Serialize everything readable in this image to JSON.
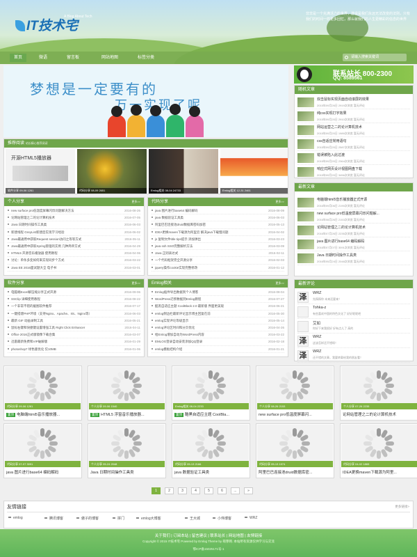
{
  "header": {
    "logo_text": "IT技术宅",
    "tagline": "A Blog About Tech",
    "intro": "非非是一个充满活力的世界，游说是我们永远无法改变的法则，只有我们的时间一样更多回忆，那么就我们的人生更精彩的信念的世界"
  },
  "nav": {
    "items": [
      {
        "label": "首页",
        "active": true
      },
      {
        "label": "微语",
        "active": false
      },
      {
        "label": "留言板",
        "active": false
      },
      {
        "label": "网站地图",
        "active": false
      },
      {
        "label": "标签分类",
        "active": false
      }
    ],
    "search_placeholder": "请输入搜索关键词"
  },
  "banner": {
    "line1": "梦想是一定要有的",
    "line2": "万一实现了呢"
  },
  "contact": {
    "title": "联系站长 800-2300",
    "qq": "QQ: 8589561"
  },
  "recommend": {
    "title": "推荐阅读",
    "subtitle": "站长精心推荐阅读",
    "items": [
      {
        "caption": "开源HTML5播放器",
        "meta": "软件分享  09-06  1261"
      },
      {
        "caption": "",
        "meta": "代码分享  08-09  2651"
      },
      {
        "caption": "",
        "meta": "Emlog相关  08-04  24733"
      },
      {
        "caption": "",
        "meta": "Emlog相关  12-31  2461"
      }
    ]
  },
  "personal": {
    "title": "个人分享",
    "more": "更多>>",
    "rows": [
      {
        "text": "new surface pro低温度屏幕闪烁问题解决方法",
        "date": "2016-08-26"
      },
      {
        "text": "论网站管理之二的论计算机技术",
        "date": "2016-07-05"
      },
      {
        "text": "Java 日期时间操作工具类",
        "date": "2016-06-03"
      },
      {
        "text": "新建线程 GreyList新建后实现学习经验",
        "date": "2016-06-02"
      },
      {
        "text": "Java最通用中获取Request session访问之等等方式",
        "date": "2016-05-11"
      },
      {
        "text": "Java最通用中获取Spring管理的实例 几种简单方式",
        "date": "2016-04-29"
      },
      {
        "text": "HTML5 开源音乐播放器 使用教程",
        "date": "2016-04-06"
      },
      {
        "text": "讨论：单条多变如何来实现同步个方式",
        "date": "2016-03-22"
      },
      {
        "text": "Java EE 2016面试题大全 电子书",
        "date": "2016-03-01"
      }
    ]
  },
  "code": {
    "title": "代码分享",
    "more": "更多>>",
    "rows": [
      {
        "text": "java 图片进行base64 编码解码",
        "date": "2016-08-09"
      },
      {
        "text": "java 数据验证工具类",
        "date": "2016-06-03"
      },
      {
        "text": "阿里巴巴连接池druid数据库密码加密",
        "date": "2016-05-13"
      },
      {
        "text": "IDEA更换maven下载源为阿里云 解决java下载慢问题",
        "date": "2016-04-02"
      },
      {
        "text": "js 复制文件title tips提示 添加弹出",
        "date": "2016-03-23"
      },
      {
        "text": "java ssh SSO完整解析方法",
        "date": "2016-03-09"
      },
      {
        "text": "Java 正则表达式",
        "date": "2016-02-11"
      },
      {
        "text": "一个代码框架完全开源分享",
        "date": "2016-02-03"
      },
      {
        "text": "jquery操作cookie实现完整修改",
        "date": "2016-01-12"
      }
    ]
  },
  "software": {
    "title": "软件分享",
    "more": "更多>>",
    "rows": [
      {
        "text": "电脑端Excel解压缩分享正式开源",
        "date": "2016-09-06"
      },
      {
        "text": "SSClip 详细使用教程",
        "date": "2016-08-22"
      },
      {
        "text": "一个非常不错的截图软件推荐",
        "date": "2016-07-17"
      },
      {
        "text": "一键搭建PHP环境（支持Nginx、Apache、IIS、Nginx等）",
        "date": "2016-06-03"
      },
      {
        "text": "最新 GIF 动画录制工具",
        "date": "2016-05-21"
      },
      {
        "text": "鼠标右键和快捷键设置增强工具 Right Click Enhancer",
        "date": "2016-04-11"
      },
      {
        "text": "Office 2016正式版镜像下载合集",
        "date": "2016-03-07"
      },
      {
        "text": "迅雷最新免费和VIP破解版",
        "date": "2016-01-29"
      },
      {
        "text": "photoshop7 绿色版优化 仅10MB",
        "date": "2016-01-06"
      }
    ]
  },
  "emlog": {
    "title": "Emlog相关",
    "more": "更多>>",
    "rows": [
      {
        "text": "Emlog插件导出数据到个人博客",
        "date": "2016-08-04"
      },
      {
        "text": "WordPress迁移数据到Emlog教程",
        "date": "2016-07-27"
      },
      {
        "text": "酷黑自适应主题 CoolBlack 2.0 最新版 界面更美观",
        "date": "2016-06-21"
      },
      {
        "text": "emlog侧边栏最新评论显示博主回复在前",
        "date": "2016-05-30"
      },
      {
        "text": "emlog实现评论等级显示",
        "date": "2016-05-14"
      },
      {
        "text": "emlog评论区时间和分页优化",
        "date": "2016-04-26"
      },
      {
        "text": "给Emlog增加自动为WordPress内容",
        "date": "2016-03-22"
      },
      {
        "text": "EMLOG登录自动安装添加QQ登录",
        "date": "2016-02-18"
      },
      {
        "text": "emlog模板结构介绍",
        "date": "2016-01-21"
      }
    ]
  },
  "random": {
    "title": "随机文章",
    "items": [
      {
        "title": "双击鼠标实现页面自动滚屏的效果",
        "meta": "2015年09月26日  2919次浏览  暂无评论"
      },
      {
        "title": "纯css实现打字效果",
        "meta": "2015年09月20日  2910次浏览  暂无评论"
      },
      {
        "title": "网站运营之二的论计算机技术",
        "meta": "2015年09月20日  1989次浏览  暂无评论"
      },
      {
        "title": "css自适应常用语句",
        "meta": "2015年09月20日  2587次浏览  暂无评论"
      },
      {
        "title": "错误被陷入此过渡",
        "meta": "2015年09月20日  2364次浏览  暂无评论"
      },
      {
        "title": "响应式网页设计视图网盘下载",
        "meta": "2015年09月20日  3456次浏览  暂无评论"
      }
    ]
  },
  "latest": {
    "title": "最新文章",
    "items": [
      {
        "title": "电脑端html5音乐播放器正式开源",
        "meta": "2016年09月06日  2190次浏览  暂无评论"
      },
      {
        "title": "new surface pro低温度屏幕闪烁问题解...",
        "meta": "2016年08月26日  2153次浏览  暂无评论"
      },
      {
        "title": "论网站管理之二的论计算机技术",
        "meta": "2016年07月26日  2235次浏览  暂无评论"
      },
      {
        "title": "java 图片进行base64 编码解码",
        "meta": "2016年07月07日  3091次浏览  暂无评论"
      },
      {
        "title": "Java 日期时间操作工具类",
        "meta": "2016年05月24日  2048次浏览  暂无评论"
      }
    ]
  },
  "comments": {
    "title": "最新评论",
    "items": [
      {
        "avatar": "泽",
        "name": "WRZ",
        "text": "先踩踩你 未来还要来！"
      },
      {
        "avatar": "",
        "name": "Tohka-z",
        "text": "有些喜欢中国的特色文化了 好好呢呢吧"
      },
      {
        "avatar": "",
        "name": "艾如",
        "text": "你好下来我很好 好有点儿了 高的"
      },
      {
        "avatar": "泽",
        "name": "WRZ",
        "text": "这该怎样还不错呀！"
      },
      {
        "avatar": "泽",
        "name": "WRZ",
        "text": "还不错的文章，我要转载给我的朋友看！"
      }
    ]
  },
  "cards": [
    {
      "meta": "代码分享  09-06  1261",
      "badge": "置顶",
      "title": "电脑端html5音乐播放器..."
    },
    {
      "meta": "个人分享  09-06  1540",
      "badge": "置顶",
      "title": "HTML5 浮窗音乐播放器..."
    },
    {
      "meta": "Emlog相关  08-04  2233",
      "badge": "置顶",
      "title": "酷黑自适应主题 CoolBla..."
    },
    {
      "meta": "个人分享  08-26  2153",
      "badge": "",
      "title": "new surface pro低温度屏幕闪..."
    },
    {
      "meta": "个人分享  07-26  2235",
      "badge": "",
      "title": "论网站管理之二的论计算机技术"
    },
    {
      "meta": "代码分享  07-07  3091",
      "badge": "",
      "title": "java 图片进行base64 编码解码"
    },
    {
      "meta": "个人分享  05-24  2048",
      "badge": "",
      "title": "Java 日期时间操作工具类"
    },
    {
      "meta": "代码分享  05-13  2166",
      "badge": "",
      "title": "java 数据验证工具类"
    },
    {
      "meta": "代码分享  05-13  1974",
      "badge": "",
      "title": "阿里巴巴连接池druid数据库密..."
    },
    {
      "meta": "代码分享  04-02  1865",
      "badge": "",
      "title": "IDEA更换maven下载源为阿里..."
    }
  ],
  "pager": [
    "1",
    "2",
    "3",
    "4",
    "5",
    "6",
    "...",
    "»"
  ],
  "friend_links": {
    "title": "友情链接",
    "more": "更多链接>",
    "items": [
      "emlog",
      "腾讯博客",
      "傲子的博客",
      "拼门",
      "emlog大博客",
      "王大城",
      "小伟博客",
      "WRZ"
    ]
  },
  "footer": {
    "links": "关于我们  |  订阅本站  |  留言建议  |  联系站长  |  网站地图  |  友情链接",
    "copyright": "Copyright © 2015 IT技术宅 Powered by Emlog Theme by 萌芽网. 本站所有资源仅供学习与交流",
    "icp": "鄂ICP备15025171号-1"
  }
}
